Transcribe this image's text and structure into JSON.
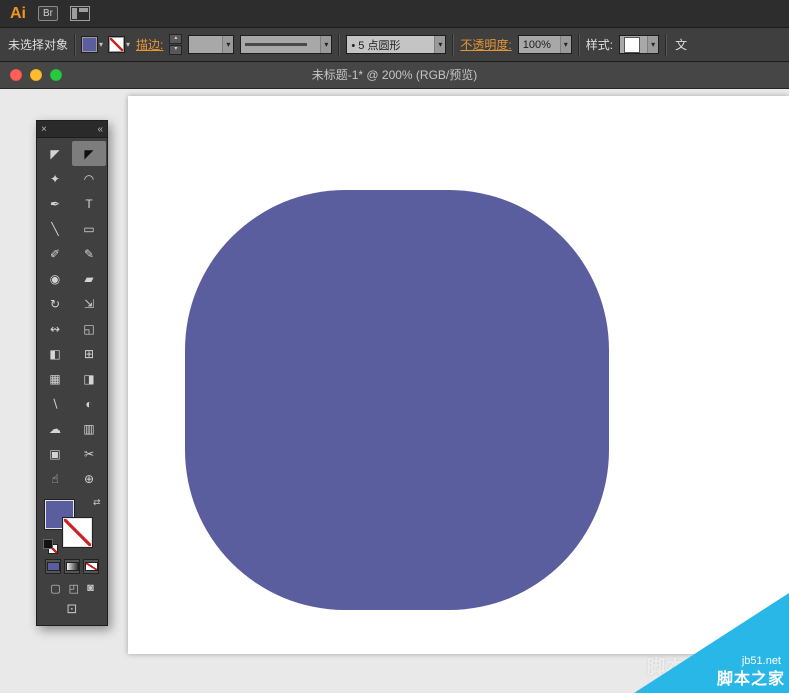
{
  "app_bar": {
    "logo": "Ai",
    "bridge_button": "Br"
  },
  "control_bar": {
    "selection_status": "未选择对象",
    "stroke_label": "描边:",
    "stroke_weight_value": "",
    "brush_preset": "• 5 点圆形",
    "opacity_label": "不透明度:",
    "opacity_value": "100%",
    "style_label": "样式:",
    "overflow_label": "文"
  },
  "title_bar": {
    "title": "未标题-1* @ 200% (RGB/预览)"
  },
  "icons": {
    "dropdown_arrow": "▾",
    "stepper_up": "▴",
    "stepper_down": "▾",
    "swap": "⇄",
    "close": "×",
    "collapse": "«"
  },
  "tool_panel": {
    "tools": [
      {
        "name": "selection-tool",
        "glyph": "◤"
      },
      {
        "name": "direct-selection-tool",
        "glyph": "◤"
      },
      {
        "name": "magic-wand-tool",
        "glyph": "✦"
      },
      {
        "name": "lasso-tool",
        "glyph": "◠"
      },
      {
        "name": "pen-tool",
        "glyph": "✒"
      },
      {
        "name": "type-tool",
        "glyph": "T"
      },
      {
        "name": "line-segment-tool",
        "glyph": "╲"
      },
      {
        "name": "rectangle-tool",
        "glyph": "▭"
      },
      {
        "name": "paintbrush-tool",
        "glyph": "✐"
      },
      {
        "name": "pencil-tool",
        "glyph": "✎"
      },
      {
        "name": "blob-brush-tool",
        "glyph": "◉"
      },
      {
        "name": "eraser-tool",
        "glyph": "▰"
      },
      {
        "name": "rotate-tool",
        "glyph": "↻"
      },
      {
        "name": "scale-tool",
        "glyph": "⇲"
      },
      {
        "name": "width-tool",
        "glyph": "↭"
      },
      {
        "name": "free-transform-tool",
        "glyph": "◱"
      },
      {
        "name": "shape-builder-tool",
        "glyph": "◧"
      },
      {
        "name": "perspective-grid-tool",
        "glyph": "⊞"
      },
      {
        "name": "mesh-tool",
        "glyph": "▦"
      },
      {
        "name": "gradient-tool",
        "glyph": "◨"
      },
      {
        "name": "eyedropper-tool",
        "glyph": "∖"
      },
      {
        "name": "blend-tool",
        "glyph": "◐"
      },
      {
        "name": "symbol-sprayer-tool",
        "glyph": "☁"
      },
      {
        "name": "column-graph-tool",
        "glyph": "▥"
      },
      {
        "name": "artboard-tool",
        "glyph": "▣"
      },
      {
        "name": "slice-tool",
        "glyph": "✂"
      },
      {
        "name": "hand-tool",
        "glyph": "☝"
      },
      {
        "name": "zoom-tool",
        "glyph": "⊕"
      }
    ],
    "drawing_modes": [
      {
        "name": "draw-normal",
        "glyph": "▢"
      },
      {
        "name": "draw-behind",
        "glyph": "◰"
      },
      {
        "name": "draw-inside",
        "glyph": "◙"
      }
    ],
    "screen_mode_glyph": "⊡"
  },
  "artboard": {
    "shape_color": "#5a5d9e"
  },
  "watermark": {
    "url": "jb51.net",
    "site_name": "脚本之家",
    "ghost_text": "脚本之家",
    "color": "#29b7e8"
  },
  "colors": {
    "accent_orange": "#e49536",
    "ui_dark": "#3f3f3f",
    "canvas_gray": "#e9e9e9",
    "shape_purple": "#5a5d9e"
  }
}
